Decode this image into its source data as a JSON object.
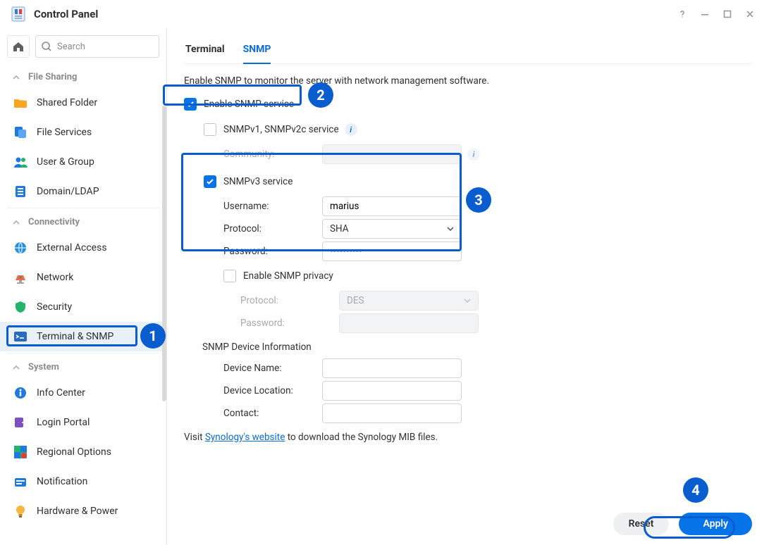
{
  "title": "Control Panel",
  "search_placeholder": "Search",
  "sections": {
    "file_sharing": "File Sharing",
    "connectivity": "Connectivity",
    "system": "System"
  },
  "nav": {
    "shared_folder": "Shared Folder",
    "file_services": "File Services",
    "user_group": "User & Group",
    "domain_ldap": "Domain/LDAP",
    "external_access": "External Access",
    "network": "Network",
    "security": "Security",
    "terminal_snmp": "Terminal & SNMP",
    "info_center": "Info Center",
    "login_portal": "Login Portal",
    "regional_options": "Regional Options",
    "notification": "Notification",
    "hardware_power": "Hardware & Power"
  },
  "tabs": {
    "terminal": "Terminal",
    "snmp": "SNMP"
  },
  "snmp": {
    "desc": "Enable SNMP to monitor the server with network management software.",
    "enable_label": "Enable SNMP service",
    "v12_label": "SNMPv1, SNMPv2c service",
    "community_label": "Community:",
    "v3_label": "SNMPv3 service",
    "username_label": "Username:",
    "username_value": "marius",
    "protocol_label": "Protocol:",
    "protocol_value": "SHA",
    "password_label": "Password:",
    "password_value": "••••••••••",
    "privacy_label": "Enable SNMP privacy",
    "priv_protocol_label": "Protocol:",
    "priv_protocol_value": "DES",
    "priv_password_label": "Password:",
    "device_info_label": "SNMP Device Information",
    "device_name_label": "Device Name:",
    "device_location_label": "Device Location:",
    "contact_label": "Contact:",
    "mib_pre": "Visit ",
    "mib_link": "Synology's website",
    "mib_post": " to download the Synology MIB files."
  },
  "buttons": {
    "reset": "Reset",
    "apply": "Apply"
  },
  "callouts": {
    "n1": "1",
    "n2": "2",
    "n3": "3",
    "n4": "4"
  }
}
